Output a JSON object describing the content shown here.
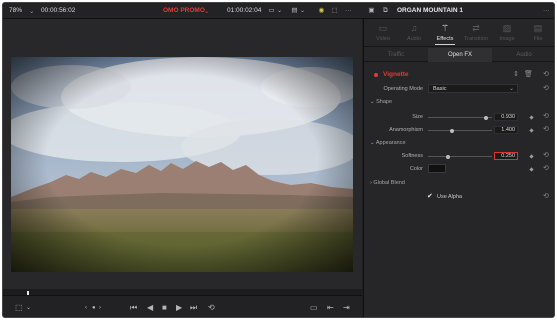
{
  "topbar": {
    "zoom": "78%",
    "timecode_left": "00:00:56:02",
    "timeline_name": "OMO PROMO",
    "timecode_right": "01:00:02:04",
    "clip_name": "ORGAN MOUNTAIN 1",
    "more": "···",
    "more_right": "···"
  },
  "inspector": {
    "tabs": [
      {
        "label": "Video",
        "icon": "video-icon"
      },
      {
        "label": "Audio",
        "icon": "music-note-icon"
      },
      {
        "label": "Effects",
        "icon": "magic-wand-icon"
      },
      {
        "label": "Transition",
        "icon": "transition-icon"
      },
      {
        "label": "Image",
        "icon": "image-icon"
      },
      {
        "label": "File",
        "icon": "file-icon"
      }
    ],
    "active_tab": "Effects",
    "subtabs": [
      "Traffic",
      "Open FX",
      "Audio"
    ],
    "active_subtab": "Open FX",
    "effect": {
      "name": "Vignette",
      "operating_mode_label": "Operating Mode",
      "operating_mode_value": "Basic"
    },
    "shape": {
      "title": "Shape",
      "size_label": "Size",
      "size_value": "0.930",
      "anamorphism_label": "Anamorphism",
      "anamorphism_value": "1.400"
    },
    "appearance": {
      "title": "Appearance",
      "softness_label": "Softness",
      "softness_value": "0.250",
      "color_label": "Color"
    },
    "global_blend": {
      "title": "Global Blend"
    },
    "use_alpha": {
      "label": "Use Alpha",
      "checked": true
    }
  },
  "colors": {
    "accent_red": "#e03a3a",
    "panel_bg": "#262628",
    "vignette_color": "#111111"
  },
  "transport": {
    "play_icons": [
      "jump-to-start-icon",
      "step-back-icon",
      "stop-icon",
      "play-icon",
      "jump-to-end-icon",
      "loop-icon"
    ]
  }
}
